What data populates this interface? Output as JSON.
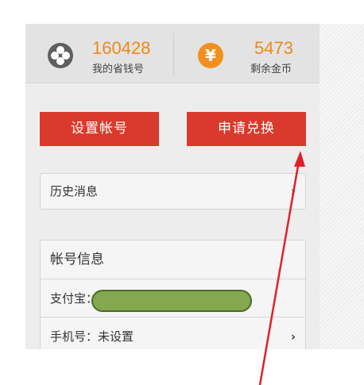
{
  "stats": {
    "savings_id": "160428",
    "savings_label": "我的省钱号",
    "coins": "5473",
    "coins_label": "剩余金币",
    "coin_icon": "flower-coin-icon",
    "yen_icon_glyph": "¥"
  },
  "buttons": {
    "settings": "设置帐号",
    "redeem": "申请兑换"
  },
  "history": {
    "label": "历史消息",
    "chevron": "›"
  },
  "account": {
    "title": "帐号信息",
    "alipay_label": "支付宝：",
    "phone_label": "手机号：未设置",
    "chevron": "›"
  },
  "colors": {
    "accent_orange": "#f08716",
    "button_red": "#d93a2b",
    "arrow_red": "#e0202a",
    "redaction_green": "#83a84f"
  }
}
